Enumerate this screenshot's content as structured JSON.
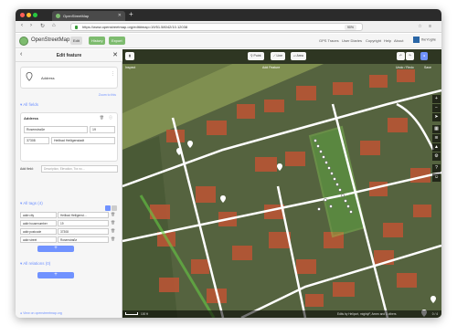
{
  "browser": {
    "tab_title": "OpenStreetMap",
    "url": "https://www.openstreetmap.org/edit#map=19/51.58042/10.12038",
    "zoom": "90%"
  },
  "app": {
    "brand": "OpenStreetMap",
    "edit_label": "Edit",
    "history_label": "History",
    "export_label": "Export",
    "links": [
      "GPS Traces",
      "User Diaries",
      "Copyright",
      "Help",
      "About"
    ],
    "user": "theYoglie"
  },
  "editor": {
    "title": "Edit feature",
    "preset_name": "Address",
    "zoom_to_link": "Zoom to this",
    "all_fields_label": "All fields",
    "address_label": "Address",
    "street_value": "Rosenstraße",
    "housenumber_value": "19",
    "postcode_value": "37308",
    "city_value": "Heilbad Heiligenstadt",
    "add_field_label": "Add field:",
    "add_field_placeholder": "Description, Elevation, Tra no…",
    "all_tags_label": "All tags (4)",
    "tags": [
      {
        "key": "addr:city",
        "value": "Heilbad Heiligenst…"
      },
      {
        "key": "addr:housenumber",
        "value": "19"
      },
      {
        "key": "addr:postcode",
        "value": "37308"
      },
      {
        "key": "addr:street",
        "value": "Rosenstraße"
      }
    ],
    "relations_label": "All relations (0)",
    "footer_link": "View on openstreetmap.org"
  },
  "map": {
    "inspect_label": "Inspect",
    "point_label": "Point",
    "line_label": "Line",
    "area_label": "Area",
    "add_feature_label": "Add Feature",
    "undo_redo_label": "Undo / Redo",
    "save_label": "Save",
    "scale_label": "100 ft",
    "attribution": "Edits by Heliport, mightyF, Amen and 1 others",
    "counter": "0 / 4"
  },
  "colors": {
    "accent": "#7092ff",
    "osm_green": "#7ebc6f",
    "selected_area": "#66cc44",
    "road": "#ffffff"
  }
}
